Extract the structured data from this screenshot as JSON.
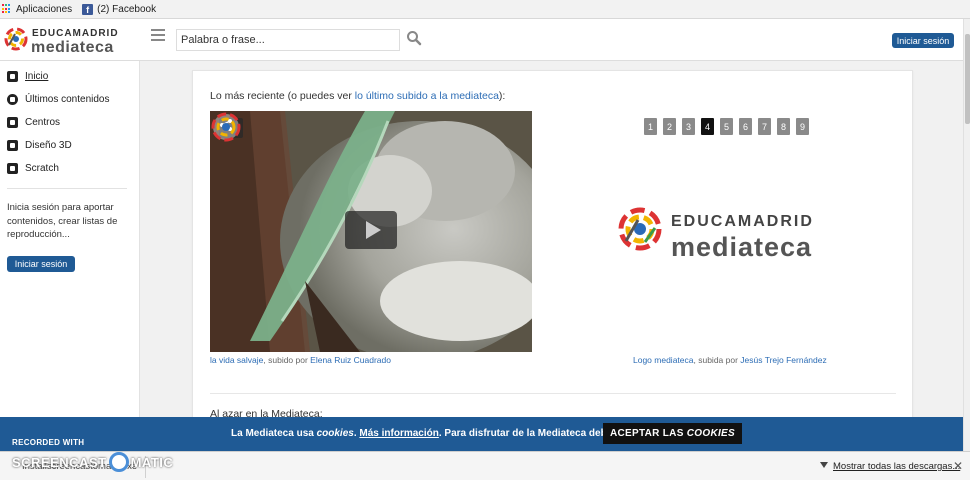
{
  "bookmarks": {
    "apps_label": "Aplicaciones",
    "facebook_label": "(2) Facebook"
  },
  "header": {
    "logo_top": "EDUCAMADRID",
    "logo_bottom": "mediateca",
    "search_placeholder": "Palabra o frase...",
    "login_label": "Iniciar sesión"
  },
  "sidebar": {
    "items": [
      {
        "label": "Inicio",
        "icon": "home-icon"
      },
      {
        "label": "Últimos contenidos",
        "icon": "clock-icon"
      },
      {
        "label": "Centros",
        "icon": "building-icon"
      },
      {
        "label": "Diseño 3D",
        "icon": "cube-icon"
      },
      {
        "label": "Scratch",
        "icon": "scratch-icon"
      }
    ],
    "info": "Inicia sesión para aportar contenidos, crear listas de reproducción...",
    "login_label": "Iniciar sesión"
  },
  "main": {
    "recent_prefix": "Lo más reciente (o puedes ver ",
    "recent_link": "lo último subido a la mediateca",
    "recent_suffix": "):",
    "video_caption": {
      "title": "la vida salvaje",
      "middle": ", subido por ",
      "author": "Elena Ruiz Cuadrado"
    },
    "pager": [
      "1",
      "2",
      "3",
      "4",
      "5",
      "6",
      "7",
      "8",
      "9"
    ],
    "pager_current": "4",
    "logo_top": "EDUCAMADRID",
    "logo_bottom": "mediateca",
    "logo_caption": {
      "title": "Logo mediateca",
      "middle": ", subida por ",
      "author": "Jesús Trejo Fernández"
    },
    "random_label": "Al azar en la Mediateca:"
  },
  "cookie": {
    "part1": "La Mediateca usa ",
    "em": "cookies",
    "part2": ". ",
    "link": "Más información",
    "part3": ". Para disfrutar de la Mediateca debes...",
    "accept_prefix": "ACEPTAR LAS ",
    "accept_em": "COOKIES"
  },
  "watermark": {
    "recorded": "RECORDED WITH",
    "brand_left": "SCREENCAST",
    "brand_right": "MATIC"
  },
  "downloads": {
    "file_label": "Installscreencastoma....exe",
    "show_all": "Mostrar todas las descargas...",
    "close": "✕"
  },
  "colors": {
    "brand_blue": "#1f5a95",
    "link_blue": "#2d6db5"
  }
}
